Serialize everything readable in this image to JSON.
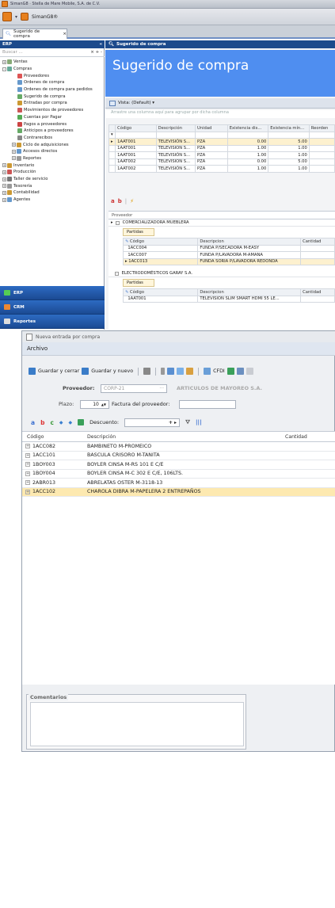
{
  "app": {
    "window_title": "SimanG8 · Stella de Mare Mobile, S.A. de C.V.",
    "app_button_label": "SimanG8®",
    "document_tab": "Sugerido de compra"
  },
  "nav": {
    "header": "ERP",
    "search_placeholder": "Buscar ...",
    "search_controls": "× + -",
    "tree": [
      {
        "label": "Ventas",
        "level": 0,
        "exp": "+",
        "color": "#8a7"
      },
      {
        "label": "Compras",
        "level": 0,
        "exp": "-",
        "color": "#6a9"
      },
      {
        "label": "Proveedores",
        "level": 1,
        "exp": "",
        "color": "#d55"
      },
      {
        "label": "Ordenes de compra",
        "level": 1,
        "exp": "",
        "color": "#69c"
      },
      {
        "label": "Ordenes de compra para pedidos",
        "level": 1,
        "exp": "",
        "color": "#69c"
      },
      {
        "label": "Sugerido de compra",
        "level": 1,
        "exp": "",
        "color": "#6a6"
      },
      {
        "label": "Entradas por compra",
        "level": 1,
        "exp": "",
        "color": "#c93"
      },
      {
        "label": "Movimientos de proveedores",
        "level": 1,
        "exp": "",
        "color": "#c55"
      },
      {
        "label": "Cuentas por Pagar",
        "level": 1,
        "exp": "",
        "color": "#5a5"
      },
      {
        "label": "Pagos a proveedores",
        "level": 1,
        "exp": "",
        "color": "#c44"
      },
      {
        "label": "Anticipos a proveedores",
        "level": 1,
        "exp": "",
        "color": "#6a6"
      },
      {
        "label": "Contrarecibos",
        "level": 1,
        "exp": "",
        "color": "#888"
      },
      {
        "label": "Ciclo de adquisiciones",
        "level": 1,
        "exp": "+",
        "color": "#c93"
      },
      {
        "label": "Accesos directos",
        "level": 1,
        "exp": "+",
        "color": "#69c"
      },
      {
        "label": "Reportes",
        "level": 1,
        "exp": "+",
        "color": "#999"
      },
      {
        "label": "Inventario",
        "level": 0,
        "exp": "+",
        "color": "#c93"
      },
      {
        "label": "Producción",
        "level": 0,
        "exp": "+",
        "color": "#c55"
      },
      {
        "label": "Taller de servicio",
        "level": 0,
        "exp": "+",
        "color": "#777"
      },
      {
        "label": "Tesorería",
        "level": 0,
        "exp": "+",
        "color": "#999"
      },
      {
        "label": "Contabilidad",
        "level": 0,
        "exp": "+",
        "color": "#c93"
      },
      {
        "label": "Agentes",
        "level": 0,
        "exp": "+",
        "color": "#69c"
      }
    ],
    "buttons": [
      {
        "label": "ERP",
        "color": "#5c5"
      },
      {
        "label": "CRM",
        "color": "#e83"
      },
      {
        "label": "Reportes",
        "color": "#ddd"
      }
    ]
  },
  "main": {
    "subheader": "Sugerido de compra",
    "banner_title": "Sugerido de compra",
    "vista_label": "Vista: (Default) ▾",
    "group_hint": "Arrastre una columna aquí para agrupar por dicha columna",
    "columns": [
      "Código",
      "Descripción",
      "Unidad",
      "Existencia dis...",
      "Existencia mín...",
      "Reorden"
    ],
    "rows": [
      [
        "1AAT001",
        "TELEVISIÓN S...",
        "PZA",
        "0.00",
        "5.00",
        ""
      ],
      [
        "1AAT001",
        "TELEVISIÓN S...",
        "PZA",
        "1.00",
        "1.00",
        ""
      ],
      [
        "1AAT001",
        "TELEVISIÓN S...",
        "PZA",
        "1.00",
        "1.00",
        ""
      ],
      [
        "1AAT002",
        "TELEVISIÓN S...",
        "PZA",
        "0.00",
        "5.00",
        ""
      ],
      [
        "1AAT002",
        "TELEVISIÓN S...",
        "PZA",
        "1.00",
        "1.00",
        ""
      ]
    ],
    "ab_labels": [
      "a",
      "b",
      "⚡"
    ],
    "prov_col": "Proveedor",
    "providers": [
      {
        "name": "COMERCIALIZADORA MUEBLERA",
        "tab": "Partidas",
        "cols": [
          "Código",
          "Descripcion",
          "Cantidad"
        ],
        "items": [
          [
            "1ACC004",
            "FUNDA P/SECADORA M-EASY",
            ""
          ],
          [
            "1ACC007",
            "FUNDA P/LAVADORA M-AMANA",
            ""
          ],
          [
            "1ACC013",
            "FUNDA SORIA P/LAVADORA REDONDA",
            ""
          ]
        ]
      },
      {
        "name": "ELECTRODOMÉSTICOS GARAY S.A.",
        "tab": "Partidas",
        "cols": [
          "Código",
          "Descripcion",
          "Cantidad"
        ],
        "items": [
          [
            "1AAT001",
            "TELEVISIÓN SLIM SMART HDMI 55 LE...",
            ""
          ]
        ]
      }
    ]
  },
  "entry": {
    "title": "Nueva entrada por compra",
    "menu": "Archivo",
    "toolbar": {
      "save_close": "Guardar y cerrar",
      "save_new": "Guardar y nuevo",
      "cfdi": "CFDI"
    },
    "proveedor_label": "Proveedor:",
    "proveedor_code": "CORP-21",
    "proveedor_name": "ARTICULOS DE MAYOREO S.A.",
    "plazo_label": "Plazo:",
    "plazo_value": "10",
    "factura_label": "Factura del proveedor:",
    "factura_value": "",
    "descuento_label": "Descuento:",
    "letters": [
      "a",
      "b",
      "c"
    ],
    "columns": [
      "Código",
      "Descripción",
      "Cantidad"
    ],
    "items": [
      {
        "code": "1ACC082",
        "desc": "BAMBINETO M-PROMEICO"
      },
      {
        "code": "1ACC101",
        "desc": "BASCULA CRISORO M-TANITA"
      },
      {
        "code": "1BOY003",
        "desc": "BOYLER CINSA M-RS 101 E C/E"
      },
      {
        "code": "1BOY004",
        "desc": "BOYLER CINSA M-C 302 E C/E, 106LTS."
      },
      {
        "code": "2ABR013",
        "desc": "ABRELATAS OSTER M-3118-13"
      },
      {
        "code": "1ACC102",
        "desc": "CHAROLA DIBRA M-PAPELERA 2 ENTREPAÑOS"
      }
    ],
    "comentarios_label": "Comentarios"
  }
}
